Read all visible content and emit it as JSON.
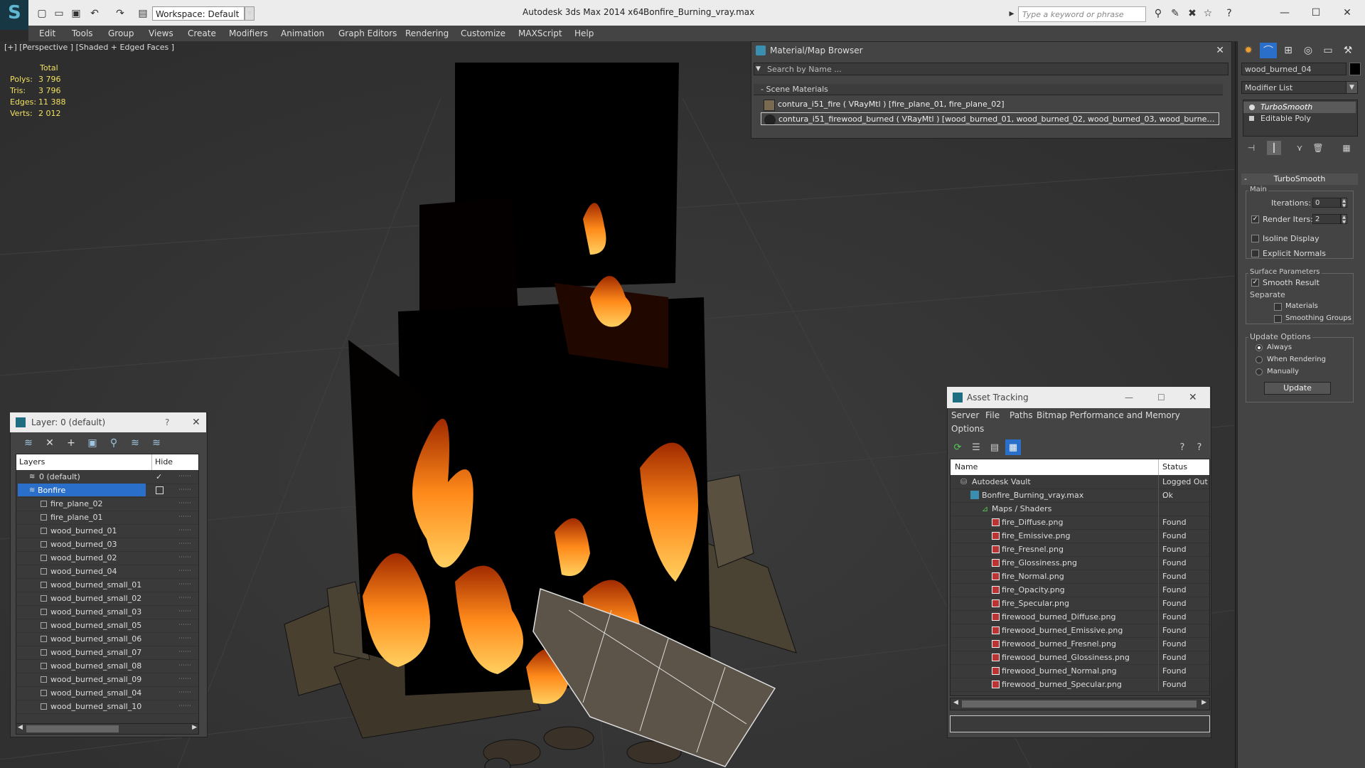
{
  "titlebar": {
    "workspace": "Workspace: Default",
    "app": "Autodesk 3ds Max  2014 x64",
    "file": "Bonfire_Burning_vray.max",
    "search_placeholder": "Type a keyword or phrase"
  },
  "menu": [
    "Edit",
    "Tools",
    "Group",
    "Views",
    "Create",
    "Modifiers",
    "Animation",
    "Graph Editors",
    "Rendering",
    "Customize",
    "MAXScript",
    "Help"
  ],
  "viewport": {
    "label": "[+] [Perspective ] [Shaded + Edged Faces ]",
    "stats": {
      "header": "Total",
      "rows": [
        {
          "label": "Polys:",
          "value": "3 796"
        },
        {
          "label": "Tris:",
          "value": "3 796"
        },
        {
          "label": "Edges:",
          "value": "11 388"
        },
        {
          "label": "Verts:",
          "value": "2 012"
        }
      ]
    }
  },
  "material_browser": {
    "title": "Material/Map Browser",
    "search_placeholder": "Search by Name ...",
    "group": "- Scene Materials",
    "items": [
      "contura_i51_fire  ( VRayMtl )  [fire_plane_01, fire_plane_02]",
      "contura_i51_firewood_burned  ( VRayMtl )  [wood_burned_01, wood_burned_02, wood_burned_03, wood_burned_04,..."
    ]
  },
  "command_panel": {
    "object_name": "wood_burned_04",
    "modifier_list": "Modifier List",
    "stack": [
      "TurboSmooth",
      "Editable Poly"
    ],
    "rollout_title": "TurboSmooth",
    "main_label": "Main",
    "iterations_label": "Iterations:",
    "iterations_value": "0",
    "render_iters_label": "Render Iters:",
    "render_iters_value": "2",
    "isoline_label": "Isoline Display",
    "explicit_label": "Explicit Normals",
    "surface_label": "Surface Parameters",
    "smooth_label": "Smooth Result",
    "separate_label": "Separate",
    "materials_label": "Materials",
    "smoothing_label": "Smoothing Groups",
    "update_options_label": "Update Options",
    "always_label": "Always",
    "when_rendering_label": "When Rendering",
    "manually_label": "Manually",
    "update_button": "Update"
  },
  "layer_panel": {
    "title": "Layer: 0 (default)",
    "help": "?",
    "col_layers": "Layers",
    "col_hide": "Hide",
    "default_layer": "0 (default)",
    "active_layer": "Bonfire",
    "objects": [
      "fire_plane_02",
      "fire_plane_01",
      "wood_burned_01",
      "wood_burned_03",
      "wood_burned_02",
      "wood_burned_04",
      "wood_burned_small_01",
      "wood_burned_small_02",
      "wood_burned_small_03",
      "wood_burned_small_05",
      "wood_burned_small_06",
      "wood_burned_small_07",
      "wood_burned_small_08",
      "wood_burned_small_09",
      "wood_burned_small_04",
      "wood_burned_small_10"
    ]
  },
  "asset_tracking": {
    "title": "Asset Tracking",
    "menu": [
      "Server",
      "File",
      "Paths",
      "Bitmap Performance and Memory",
      "Options"
    ],
    "col_name": "Name",
    "col_status": "Status",
    "rows": [
      {
        "name": "Autodesk Vault",
        "status": "Logged Out ..",
        "indent": 1
      },
      {
        "name": "Bonfire_Burning_vray.max",
        "status": "Ok",
        "indent": 2
      },
      {
        "name": "Maps / Shaders",
        "status": "",
        "indent": 3
      },
      {
        "name": "fire_Diffuse.png",
        "status": "Found",
        "indent": 4
      },
      {
        "name": "fire_Emissive.png",
        "status": "Found",
        "indent": 4
      },
      {
        "name": "fire_Fresnel.png",
        "status": "Found",
        "indent": 4
      },
      {
        "name": "fire_Glossiness.png",
        "status": "Found",
        "indent": 4
      },
      {
        "name": "fire_Normal.png",
        "status": "Found",
        "indent": 4
      },
      {
        "name": "fire_Opacity.png",
        "status": "Found",
        "indent": 4
      },
      {
        "name": "fire_Specular.png",
        "status": "Found",
        "indent": 4
      },
      {
        "name": "firewood_burned_Diffuse.png",
        "status": "Found",
        "indent": 4
      },
      {
        "name": "firewood_burned_Emissive.png",
        "status": "Found",
        "indent": 4
      },
      {
        "name": "firewood_burned_Fresnel.png",
        "status": "Found",
        "indent": 4
      },
      {
        "name": "firewood_burned_Glossiness.png",
        "status": "Found",
        "indent": 4
      },
      {
        "name": "firewood_burned_Normal.png",
        "status": "Found",
        "indent": 4
      },
      {
        "name": "firewood_burned_Specular.png",
        "status": "Found",
        "indent": 4
      }
    ]
  },
  "colors": {
    "stats": "#f0e060",
    "selection": "#2a6fc9",
    "fire": "#ff8a1a",
    "panel": "#444444"
  }
}
